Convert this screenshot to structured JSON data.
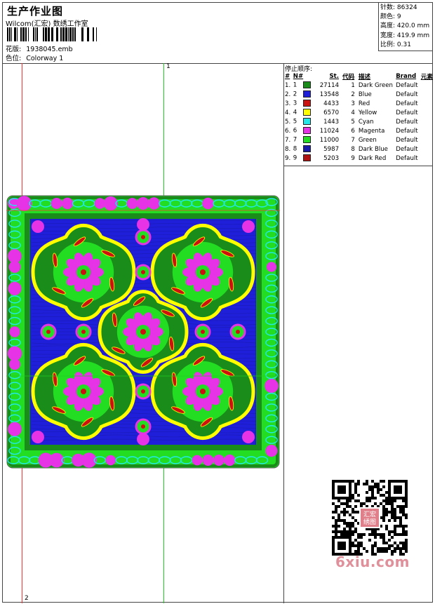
{
  "header": {
    "title": "生产作业图",
    "subtitle": "Wilcom(汇宏) 数绣工作室",
    "file_label": "花版:",
    "file_value": "1938045.emb",
    "colorway_label": "色位:",
    "colorway_value": "Colorway 1"
  },
  "stats": [
    {
      "label": "针数:",
      "value": "86324"
    },
    {
      "label": "颜色:",
      "value": "9"
    },
    {
      "label": "高度:",
      "value": "420.0 mm"
    },
    {
      "label": "宽度:",
      "value": "419.9 mm"
    },
    {
      "label": "比例:",
      "value": "0.31"
    }
  ],
  "stop_sequence": {
    "title": "停止顺序:",
    "headers": [
      "#",
      "N#",
      "St.",
      "代码",
      "描述",
      "Brand",
      "元素"
    ],
    "rows": [
      {
        "n": "1.",
        "nn": "1",
        "color": "#1a8c1a",
        "st": "27114",
        "code": "1",
        "desc": "Dark Green",
        "brand": "Default"
      },
      {
        "n": "2.",
        "nn": "2",
        "color": "#1f1fd9",
        "st": "13548",
        "code": "2",
        "desc": "Blue",
        "brand": "Default"
      },
      {
        "n": "3.",
        "nn": "3",
        "color": "#cc1111",
        "st": "4433",
        "code": "3",
        "desc": "Red",
        "brand": "Default"
      },
      {
        "n": "4.",
        "nn": "4",
        "color": "#ffff00",
        "st": "6570",
        "code": "4",
        "desc": "Yellow",
        "brand": "Default"
      },
      {
        "n": "5.",
        "nn": "5",
        "color": "#22e8e8",
        "st": "1443",
        "code": "5",
        "desc": "Cyan",
        "brand": "Default"
      },
      {
        "n": "6.",
        "nn": "6",
        "color": "#e633e6",
        "st": "11024",
        "code": "6",
        "desc": "Magenta",
        "brand": "Default"
      },
      {
        "n": "7.",
        "nn": "7",
        "color": "#22dd22",
        "st": "11000",
        "code": "7",
        "desc": "Green",
        "brand": "Default"
      },
      {
        "n": "8.",
        "nn": "8",
        "color": "#1a1aa8",
        "st": "5987",
        "code": "8",
        "desc": "Dark Blue",
        "brand": "Default"
      },
      {
        "n": "9.",
        "nn": "9",
        "color": "#b01111",
        "st": "5203",
        "code": "9",
        "desc": "Dark Red",
        "brand": "Default"
      }
    ]
  },
  "guides": {
    "top_mark": "1",
    "bottom_mark": "2",
    "red_color": "#ff3030",
    "green_color": "#22cc22"
  },
  "watermark": {
    "text": "6xiu.com",
    "seal_text": "汇宏 绣图"
  }
}
